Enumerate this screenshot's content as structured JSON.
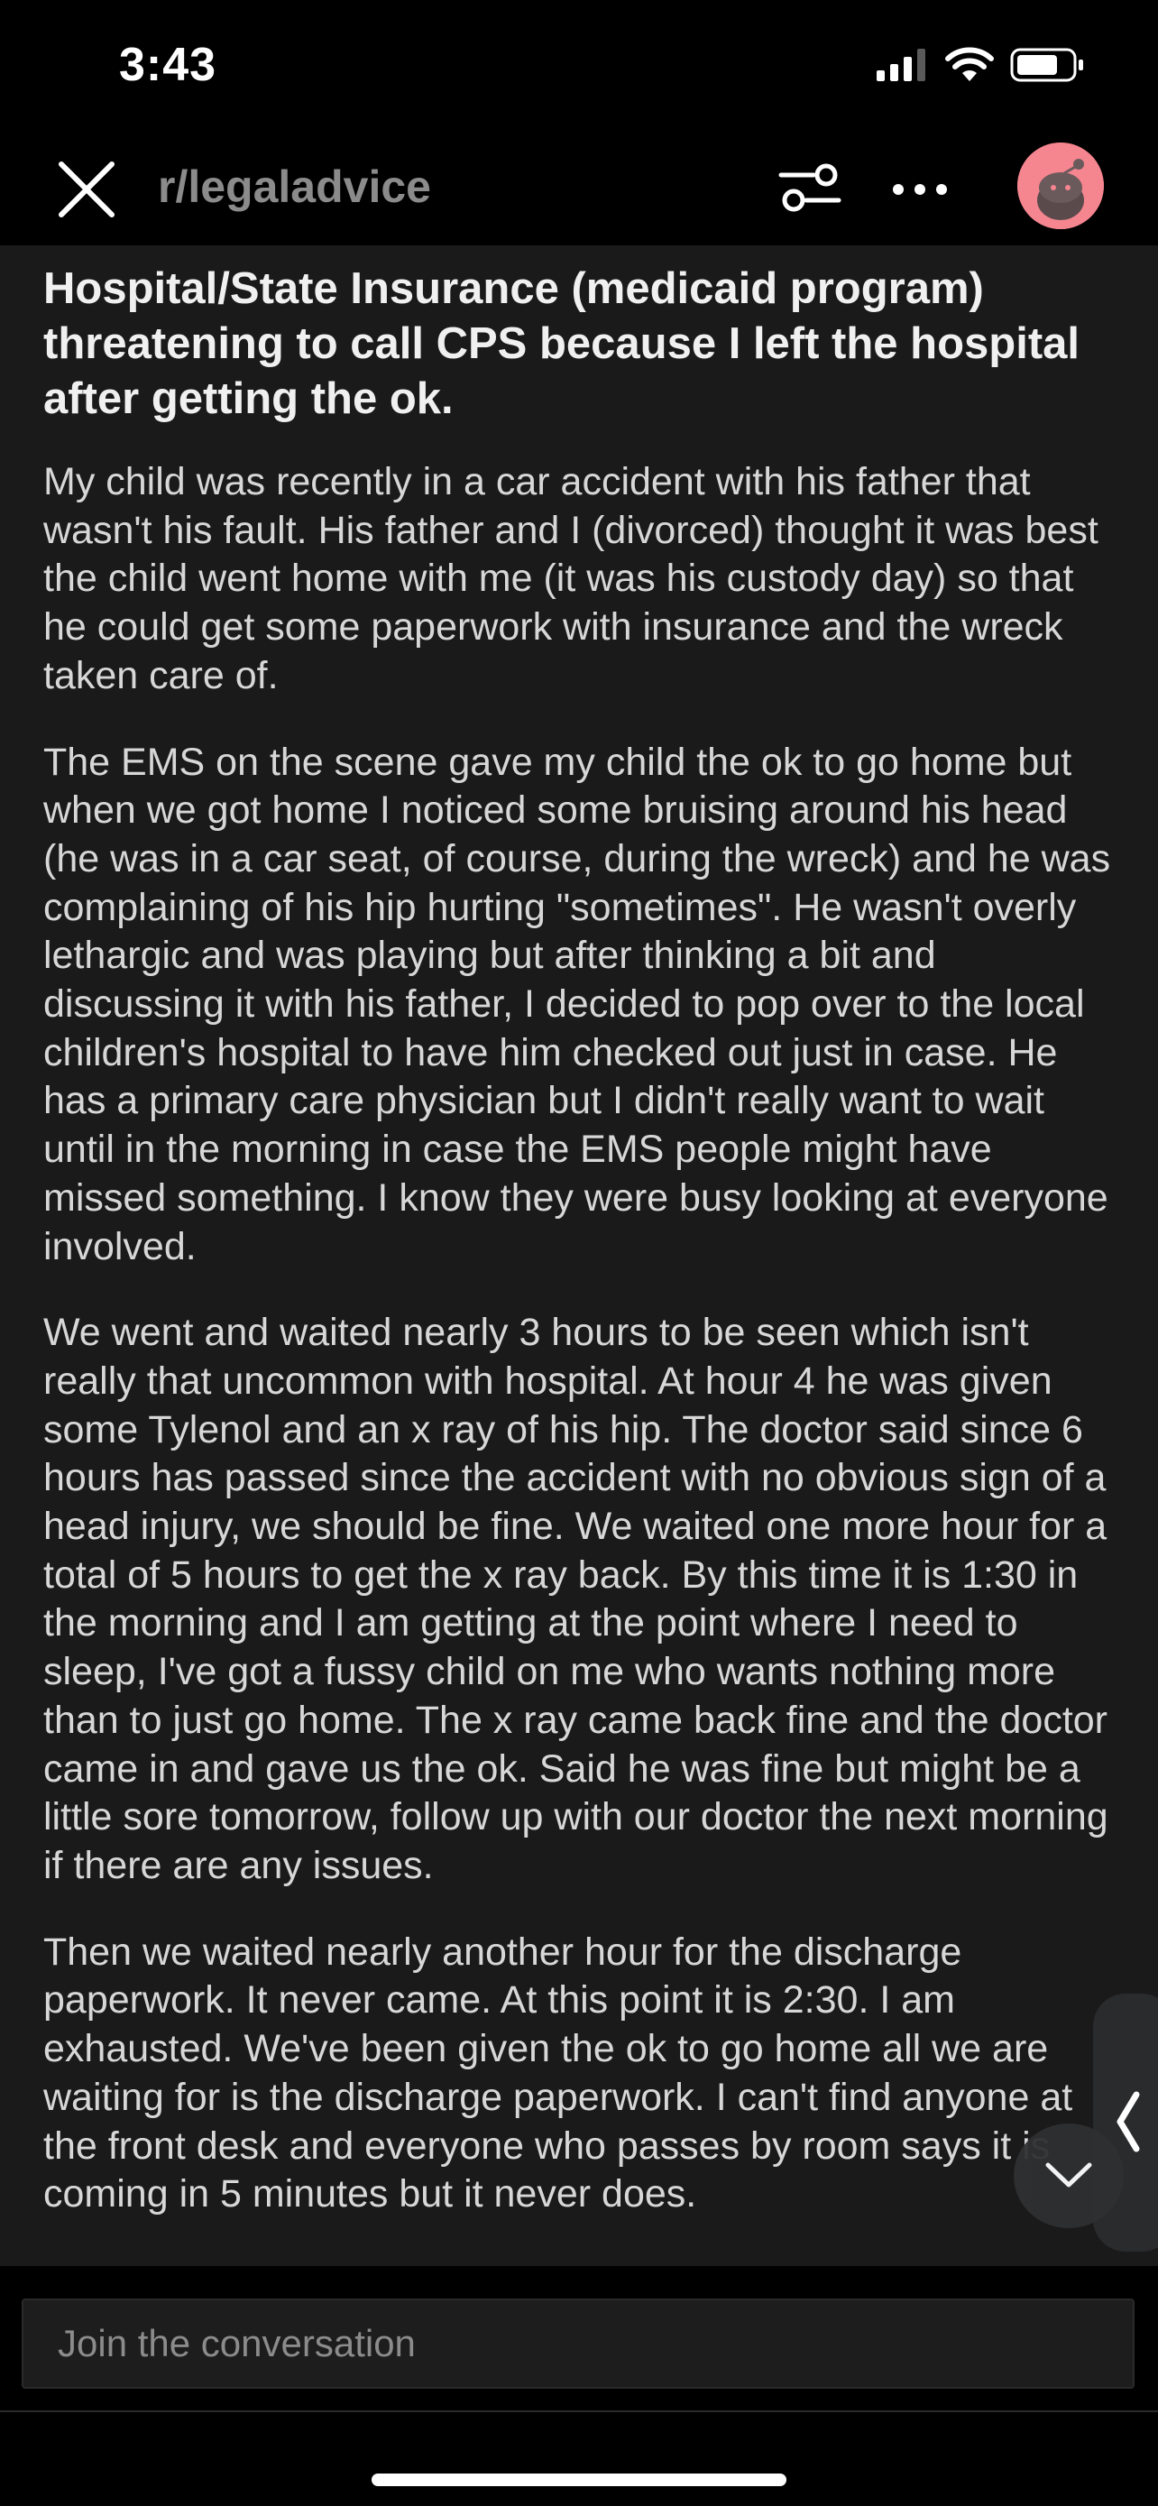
{
  "status_bar": {
    "time": "3:43"
  },
  "header": {
    "subreddit": "r/legaladvice",
    "icons": [
      "close-icon",
      "filter-icon",
      "more-icon",
      "avatar"
    ]
  },
  "post": {
    "title": "Hospital/State Insurance (medicaid program) threatening to call CPS because I left the hospital after getting the ok.",
    "paragraphs": [
      "My child was recently in a car accident with his father that wasn't his fault. His father and I (divorced) thought it was best the child went home with me (it was his custody day) so that he could get some paperwork with insurance and the wreck taken care of.",
      "The EMS on the scene gave my child the ok to go home but when we got home I noticed some bruising around his head (he was in a car seat, of course, during the wreck) and he was complaining of his hip hurting \"sometimes\". He wasn't overly lethargic and was playing but after thinking a bit and discussing it with his father, I decided to pop over to the local children's hospital to have him checked out just in case. He has a primary care physician but I didn't really want to wait until in the morning in case the EMS people might have missed something. I know they were busy looking at everyone involved.",
      "We went and waited nearly 3 hours to be seen which isn't really that uncommon with hospital.  At hour 4 he was given some Tylenol and an x ray of his hip. The doctor said since 6 hours has passed since the accident with no obvious sign of a head injury, we should be fine. We waited one more hour for a total of 5 hours to get the x ray back. By this time it is 1:30 in the morning and I am getting at the point where I need to sleep, I've got a fussy child on me who wants nothing more than to just go home. The x ray came back fine and the doctor came in and gave us the ok. Said he was fine but might be a little sore tomorrow, follow up with our doctor the next morning if there are any issues.",
      "Then we waited nearly another hour for the discharge paperwork. It never came. At this point it is 2:30. I am exhausted. We've been given the ok to go home all we are waiting for is the discharge paperwork. I can't find anyone at the front desk and everyone who passes by room says it is coming in 5 minutes but it never does."
    ]
  },
  "comment_box": {
    "placeholder": "Join the conversation"
  },
  "colors": {
    "background": "#000000",
    "content_bg": "#1a1a1b",
    "avatar_bg": "#f5858f",
    "subreddit_text": "#8b8b8b"
  }
}
